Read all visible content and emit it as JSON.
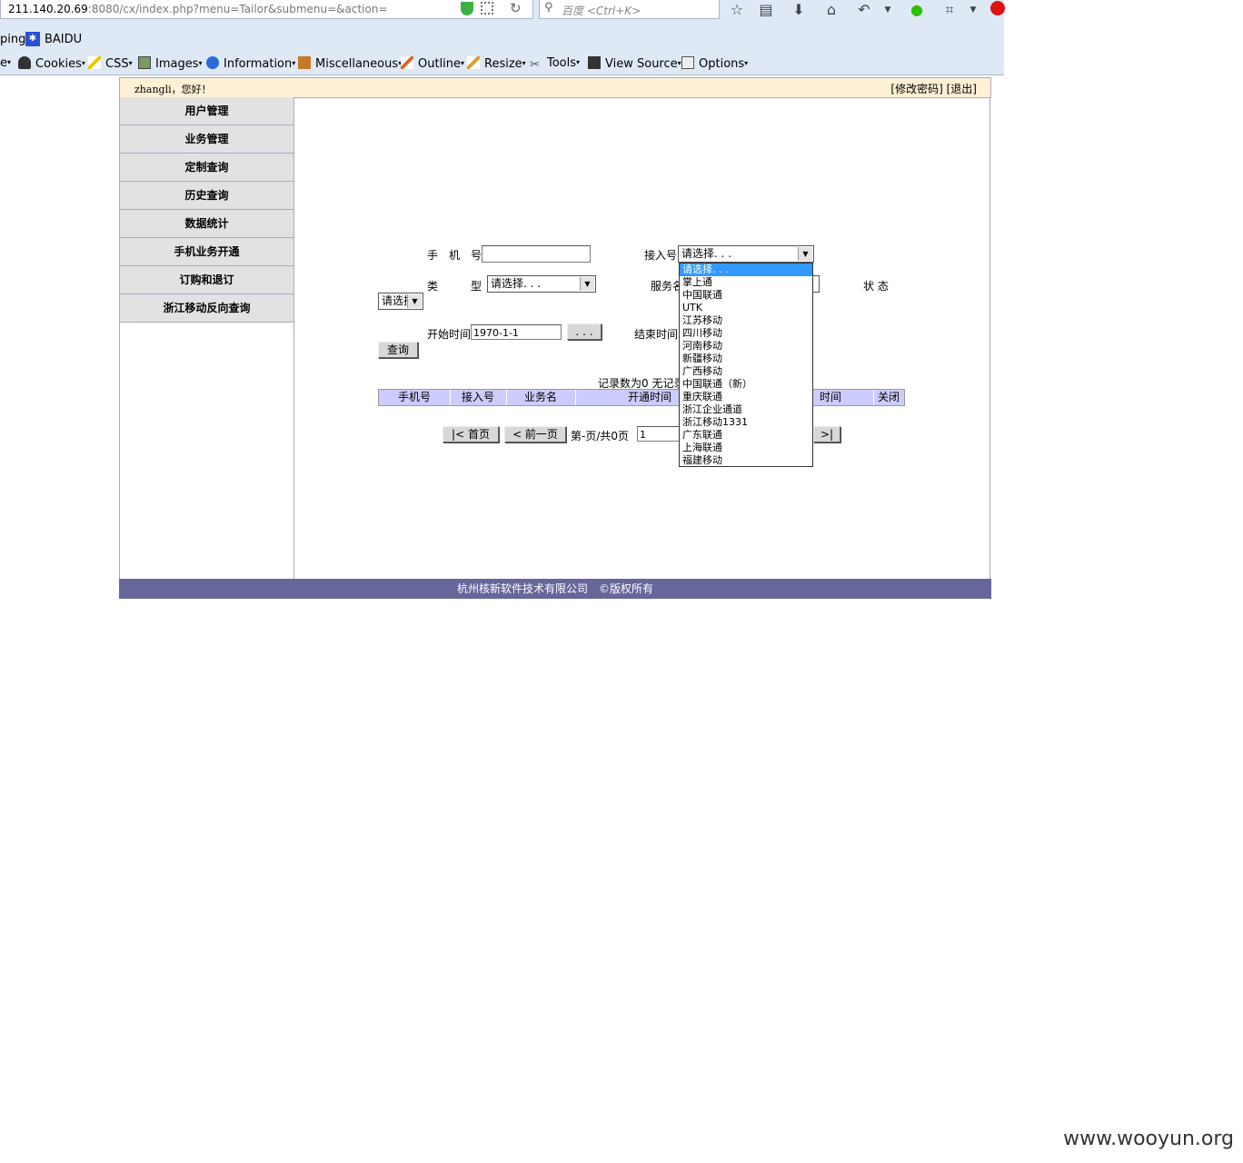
{
  "browser": {
    "url_host": "211.140.20.69",
    "url_rest": ":8080/cx/index.php?menu=Tailor&submenu=&action=",
    "search_placeholder": "百度 <Ctrl+K>",
    "bookmarks": [
      "ping",
      "BAIDU"
    ],
    "webdev_menus": [
      "e",
      "Cookies",
      "CSS",
      "Images",
      "Information",
      "Miscellaneous",
      "Outline",
      "Resize",
      "Tools",
      "View Source",
      "Options"
    ]
  },
  "header": {
    "greeting": "zhangli，您好！",
    "change_password": "[修改密码]",
    "logout": "[退出]"
  },
  "sidebar": {
    "items": [
      "用户管理",
      "业务管理",
      "定制查询",
      "历史查询",
      "数据统计",
      "手机业务开通",
      "订购和退订",
      "浙江移动反向查询"
    ]
  },
  "form": {
    "phone_label": "手　机　号",
    "phone_value": "",
    "access_label": "接入号",
    "access_selected": "请选择. . .",
    "type_label": "类　　　型",
    "type_selected": "请选择. . .",
    "service_label": "服务名",
    "status_label": "状  态",
    "status_selected": "请选择. . .",
    "start_label": "开始时间",
    "start_value": "1970-1-1",
    "picker_button": ". . .",
    "end_label": "结束时间",
    "query_button": "查询"
  },
  "results": {
    "record_count": "记录数为0  无记录",
    "columns": [
      "手机号",
      "接入号",
      "业务名",
      "开通时间",
      "",
      "时间",
      "关闭"
    ]
  },
  "pager": {
    "first": "|< 首页",
    "prev": "< 前一页",
    "page_info": "第-页/共0页",
    "page_input": "1",
    "last": ">|"
  },
  "dropdown_options": [
    "请选择. . .",
    "掌上通",
    "中国联通",
    "UTK",
    "江苏移动",
    "四川移动",
    "河南移动",
    "新疆移动",
    "广西移动",
    "中国联通（新）",
    "重庆联通",
    "浙江企业通道",
    "浙江移动1331",
    "广东联通",
    "上海联通",
    "福建移动"
  ],
  "footer": {
    "text": "杭州核新软件技术有限公司　©版权所有"
  },
  "watermark": "www.wooyun.org"
}
